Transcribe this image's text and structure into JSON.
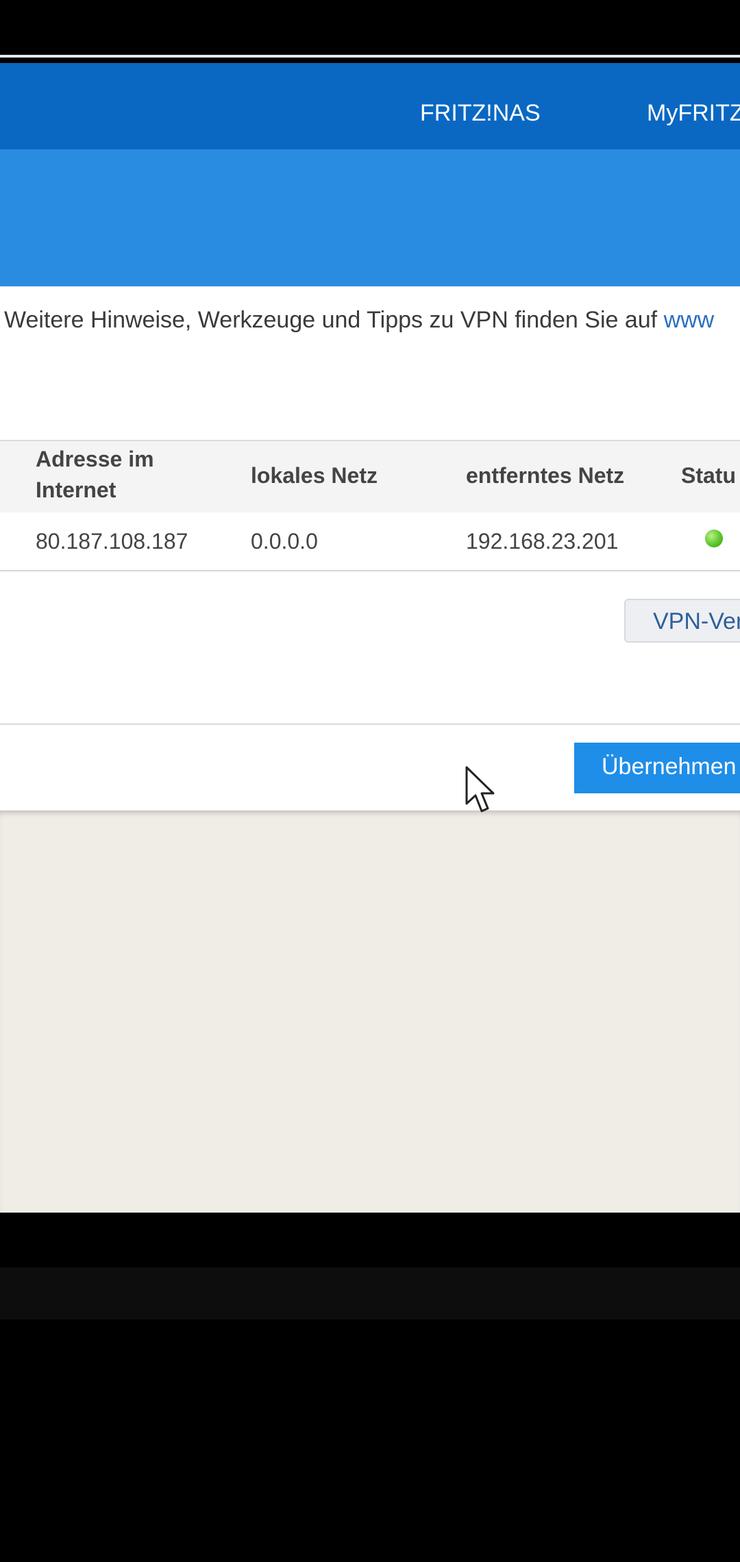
{
  "topnav": {
    "items": [
      {
        "label": "FRITZ!NAS"
      },
      {
        "label": "MyFRITZ"
      }
    ],
    "background": "#0a68c2"
  },
  "subnav": {
    "background": "#2a8ce0",
    "active_indicator": "#e4ec14"
  },
  "hint": {
    "text": "Weitere Hinweise, Werkzeuge und Tipps zu VPN finden Sie auf ",
    "link": "www"
  },
  "table": {
    "headers": {
      "address_line1": "Adresse im",
      "address_line2": "Internet",
      "local_net": "lokales Netz",
      "remote_net": "entferntes Netz",
      "status": "Statu"
    },
    "rows": [
      {
        "address": "80.187.108.187",
        "local_net": "0.0.0.0",
        "remote_net": "192.168.23.201",
        "status_color": "#5cc62a"
      }
    ]
  },
  "buttons": {
    "vpn": "VPN-Ver",
    "apply": "Übernehmen"
  },
  "cursor": {
    "icon": "mouse-pointer-icon"
  }
}
